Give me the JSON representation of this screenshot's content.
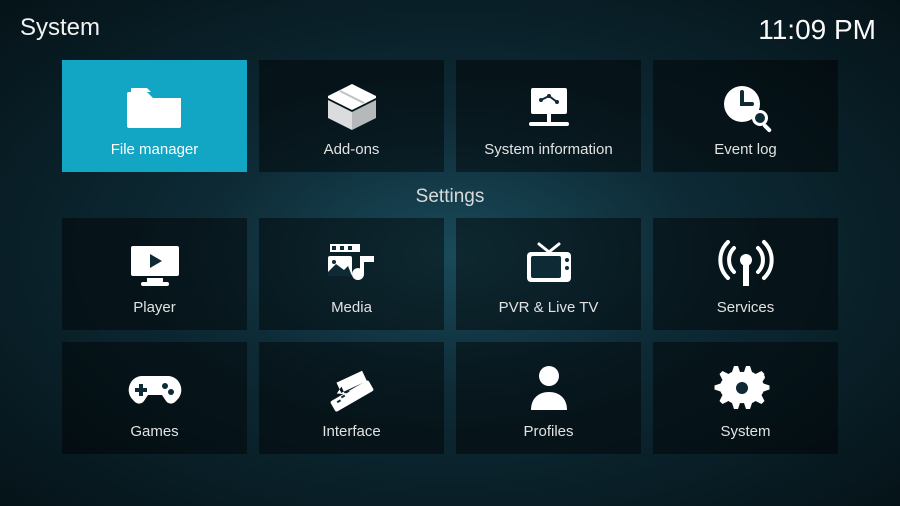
{
  "header": {
    "title": "System",
    "clock": "11:09 PM"
  },
  "top_row": [
    {
      "id": "file-manager",
      "label": "File manager",
      "icon": "folder-icon",
      "selected": true
    },
    {
      "id": "add-ons",
      "label": "Add-ons",
      "icon": "box-icon",
      "selected": false
    },
    {
      "id": "system-information",
      "label": "System information",
      "icon": "presentation-icon",
      "selected": false
    },
    {
      "id": "event-log",
      "label": "Event log",
      "icon": "clock-search-icon",
      "selected": false
    }
  ],
  "section_heading": "Settings",
  "grid": [
    [
      {
        "id": "player",
        "label": "Player",
        "icon": "monitor-play-icon"
      },
      {
        "id": "media",
        "label": "Media",
        "icon": "media-library-icon"
      },
      {
        "id": "pvr-live-tv",
        "label": "PVR & Live TV",
        "icon": "tv-icon"
      },
      {
        "id": "services",
        "label": "Services",
        "icon": "broadcast-icon"
      }
    ],
    [
      {
        "id": "games",
        "label": "Games",
        "icon": "gamepad-icon"
      },
      {
        "id": "interface",
        "label": "Interface",
        "icon": "ruler-pencil-icon"
      },
      {
        "id": "profiles",
        "label": "Profiles",
        "icon": "person-icon"
      },
      {
        "id": "system",
        "label": "System",
        "icon": "gear-wrench-icon"
      }
    ]
  ]
}
